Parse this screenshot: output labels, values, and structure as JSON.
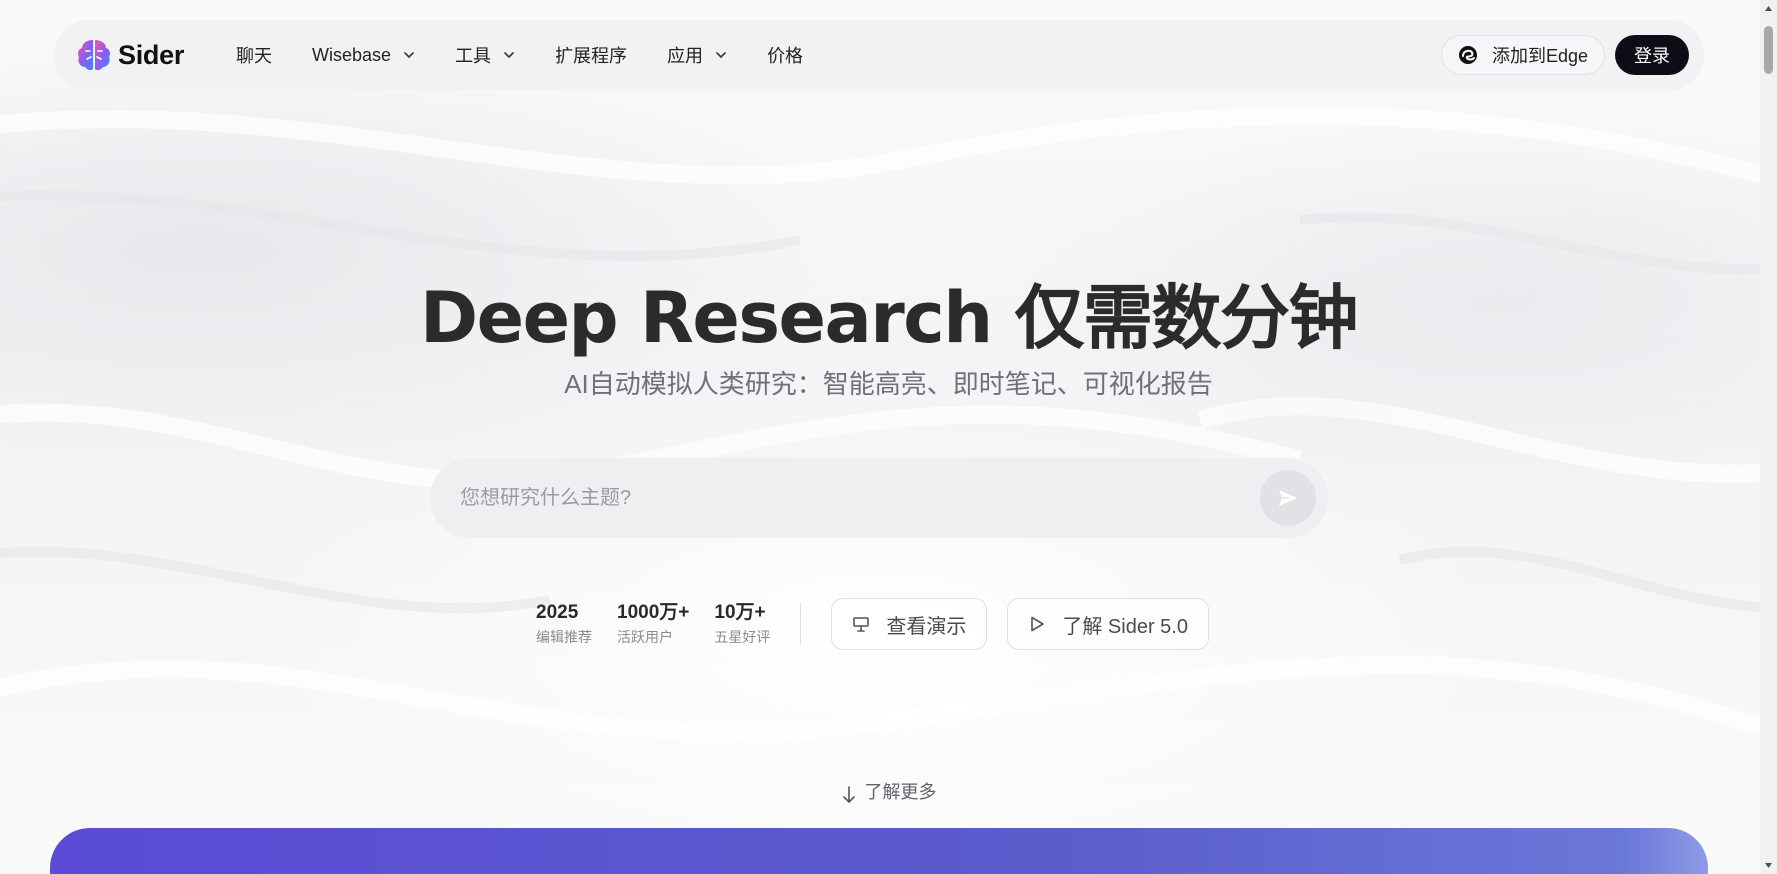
{
  "header": {
    "logo_text": "Sider",
    "nav": [
      {
        "label": "聊天",
        "has_dropdown": false
      },
      {
        "label": "Wisebase",
        "has_dropdown": true
      },
      {
        "label": "工具",
        "has_dropdown": true
      },
      {
        "label": "扩展程序",
        "has_dropdown": false
      },
      {
        "label": "应用",
        "has_dropdown": true
      },
      {
        "label": "价格",
        "has_dropdown": false
      }
    ],
    "edge_button_label": "添加到Edge",
    "login_label": "登录"
  },
  "hero": {
    "title": "Deep Research 仅需数分钟",
    "subtitle": "AI自动模拟人类研究：智能高亮、即时笔记、可视化报告"
  },
  "search": {
    "value": "",
    "placeholder": "您想研究什么主题?"
  },
  "stats": [
    {
      "value": "2025",
      "label": "编辑推荐"
    },
    {
      "value": "1000万+",
      "label": "活跃用户"
    },
    {
      "value": "10万+",
      "label": "五星好评"
    }
  ],
  "buttons": {
    "demo_label": "查看演示",
    "learn_sider_label": "了解 Sider 5.0"
  },
  "learn_more_label": "了解更多",
  "colors": {
    "accent_dark": "#0d0d17",
    "banner_purple": "#5b4bd6"
  }
}
